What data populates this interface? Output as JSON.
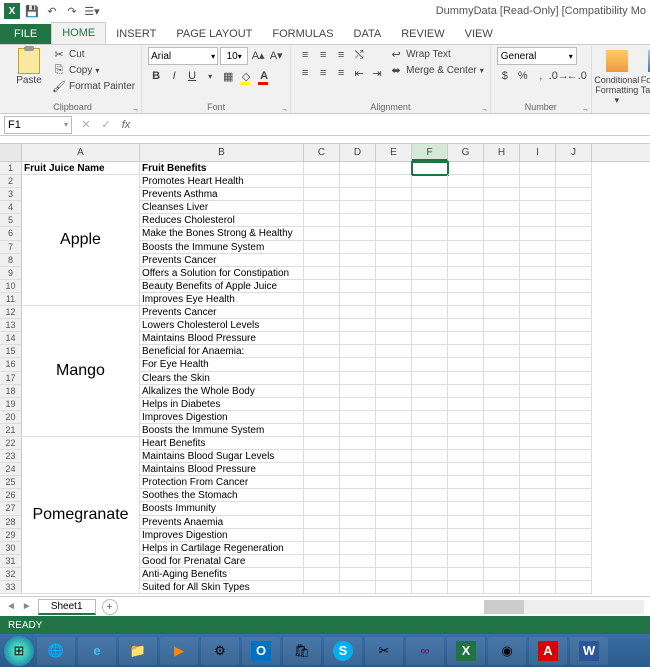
{
  "app": {
    "title": "DummyData [Read-Only] [Compatibility Mo"
  },
  "qat": {
    "save": "💾",
    "undo": "↶",
    "redo": "↷",
    "customize": "▾"
  },
  "tabs": {
    "file": "FILE",
    "home": "HOME",
    "insert": "INSERT",
    "pagelayout": "PAGE LAYOUT",
    "formulas": "FORMULAS",
    "data": "DATA",
    "review": "REVIEW",
    "view": "VIEW"
  },
  "ribbon": {
    "clipboard": {
      "label": "Clipboard",
      "paste": "Paste",
      "cut": "Cut",
      "copy": "Copy",
      "painter": "Format Painter"
    },
    "font": {
      "label": "Font",
      "name": "Arial",
      "size": "10"
    },
    "alignment": {
      "label": "Alignment",
      "wrap": "Wrap Text",
      "merge": "Merge & Center"
    },
    "number": {
      "label": "Number",
      "format": "General"
    },
    "styles": {
      "cond": "Conditional Formatting",
      "table": "Format a Table"
    }
  },
  "formula_bar": {
    "name_box": "F1",
    "formula": ""
  },
  "columns": [
    "A",
    "B",
    "C",
    "D",
    "E",
    "F",
    "G",
    "H",
    "I",
    "J"
  ],
  "col_widths": {
    "A": 118,
    "B": 164
  },
  "selected_cell": "F1",
  "headers": {
    "a": "Fruit Juice Name",
    "b": "Fruit Benefits"
  },
  "groups": [
    {
      "name": "Apple",
      "start": 2,
      "end": 11,
      "benefits": [
        "Promotes Heart Health",
        "Prevents Asthma",
        "Cleanses Liver",
        "Reduces Cholesterol",
        "Make the Bones Strong & Healthy",
        "Boosts the Immune System",
        "Prevents Cancer",
        "Offers a Solution for Constipation",
        "Beauty Benefits of Apple Juice",
        "Improves Eye Health"
      ]
    },
    {
      "name": "Mango",
      "start": 12,
      "end": 21,
      "benefits": [
        "Prevents Cancer",
        "Lowers Cholesterol Levels",
        "Maintains Blood Pressure",
        "Beneficial for Anaemia:",
        "For Eye Health",
        "Clears the Skin",
        "Alkalizes the Whole Body",
        "Helps in Diabetes",
        "Improves Digestion",
        "Boosts the Immune System"
      ]
    },
    {
      "name": "Pomegranate",
      "start": 22,
      "end": 33,
      "benefits": [
        "Heart Benefits",
        "Maintains Blood Sugar Levels",
        "Maintains Blood Pressure",
        "Protection From Cancer",
        "Soothes the Stomach",
        "Boosts Immunity",
        "Prevents Anaemia",
        "Improves Digestion",
        "Helps in Cartilage Regeneration",
        "Good for Prenatal Care",
        "Anti-Aging Benefits",
        "Suited for All Skin Types"
      ]
    }
  ],
  "sheet_tabs": {
    "active": "Sheet1"
  },
  "status": {
    "ready": "READY"
  },
  "taskbar_icons": [
    "start",
    "globe",
    "ie",
    "folder",
    "media",
    "outlook",
    "store",
    "skype",
    "snip",
    "vs",
    "excel",
    "chrome",
    "pdf",
    "word"
  ]
}
